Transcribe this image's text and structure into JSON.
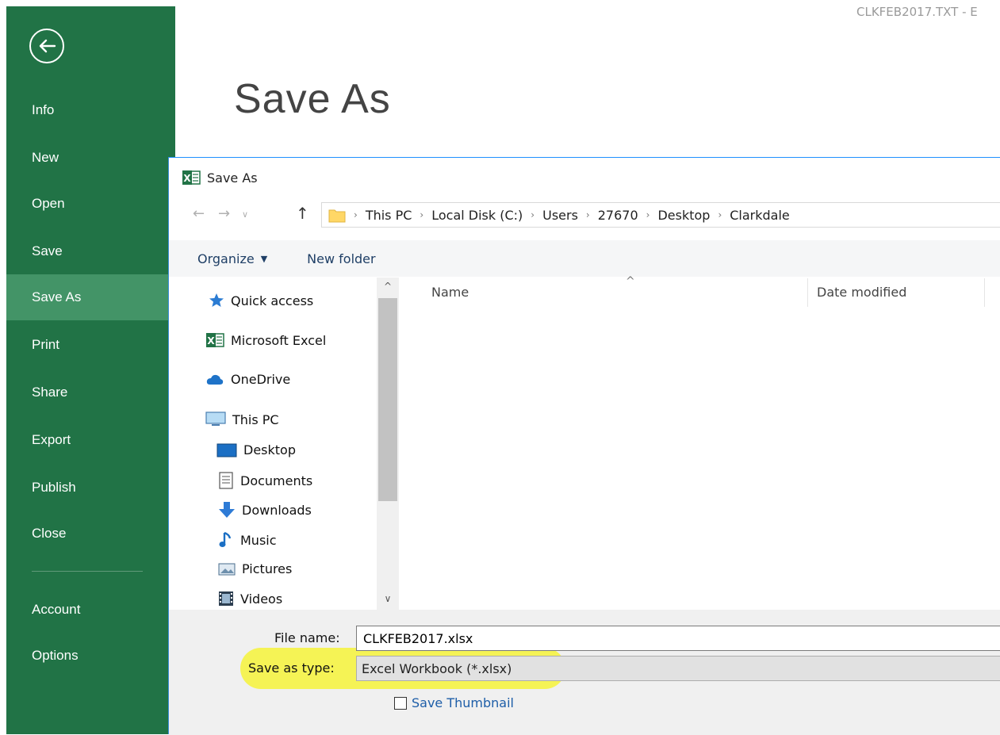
{
  "window": {
    "doc_title": "CLKFEB2017.TXT - E"
  },
  "backstage": {
    "page_title": "Save As",
    "nav": [
      {
        "label": "Info"
      },
      {
        "label": "New"
      },
      {
        "label": "Open"
      },
      {
        "label": "Save"
      },
      {
        "label": "Save As",
        "active": true
      },
      {
        "label": "Print"
      },
      {
        "label": "Share"
      },
      {
        "label": "Export"
      },
      {
        "label": "Publish"
      },
      {
        "label": "Close"
      },
      {
        "label": "Account"
      },
      {
        "label": "Options"
      }
    ],
    "colors": {
      "sidebar": "#217346",
      "active": "#439467"
    }
  },
  "dialog": {
    "title": "Save As",
    "breadcrumb": [
      "This PC",
      "Local Disk (C:)",
      "Users",
      "27670",
      "Desktop",
      "Clarkdale"
    ],
    "toolbar": {
      "organize": "Organize",
      "new_folder": "New folder"
    },
    "tree": [
      {
        "label": "Quick access",
        "icon": "star-icon"
      },
      {
        "label": "Microsoft Excel",
        "icon": "excel-icon"
      },
      {
        "label": "OneDrive",
        "icon": "cloud-icon"
      },
      {
        "label": "This PC",
        "icon": "computer-icon"
      },
      {
        "label": "Desktop",
        "icon": "desktop-icon"
      },
      {
        "label": "Documents",
        "icon": "documents-icon"
      },
      {
        "label": "Downloads",
        "icon": "downloads-icon"
      },
      {
        "label": "Music",
        "icon": "music-icon"
      },
      {
        "label": "Pictures",
        "icon": "pictures-icon"
      },
      {
        "label": "Videos",
        "icon": "videos-icon"
      }
    ],
    "columns": {
      "name": "Name",
      "date_modified": "Date modified"
    },
    "file_name_label": "File name:",
    "file_name_value": "CLKFEB2017.xlsx",
    "save_type_label": "Save as type:",
    "save_type_value": "Excel Workbook (*.xlsx)",
    "save_thumbnail": "Save Thumbnail",
    "highlight_color": "#f6f33a"
  }
}
